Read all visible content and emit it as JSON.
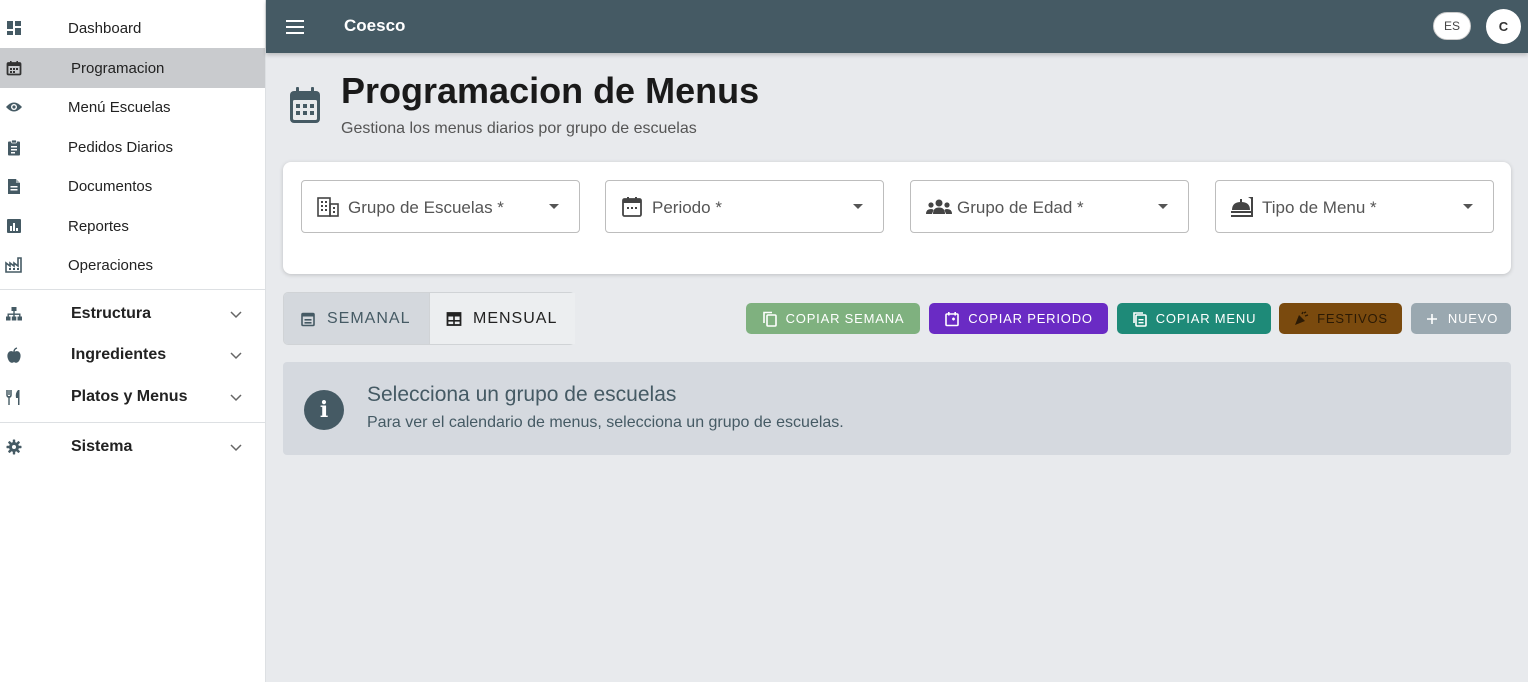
{
  "sidebar": {
    "items": [
      {
        "label": "Dashboard",
        "icon": "dashboard-icon"
      },
      {
        "label": "Programacion",
        "icon": "calendar-icon",
        "active": true
      },
      {
        "label": "Menú Escuelas",
        "icon": "eye-icon"
      },
      {
        "label": "Pedidos Diarios",
        "icon": "clipboard-icon"
      },
      {
        "label": "Documentos",
        "icon": "document-icon"
      },
      {
        "label": "Reportes",
        "icon": "chart-icon"
      },
      {
        "label": "Operaciones",
        "icon": "factory-icon"
      }
    ],
    "groups": [
      {
        "label": "Estructura",
        "icon": "sitemap-icon"
      },
      {
        "label": "Ingredientes",
        "icon": "apple-icon"
      },
      {
        "label": "Platos y Menus",
        "icon": "utensils-icon"
      },
      {
        "label": "Sistema",
        "icon": "gear-icon"
      }
    ]
  },
  "topbar": {
    "title": "Coesco",
    "language": "ES",
    "avatar_initial": "C"
  },
  "header": {
    "title": "Programacion de Menus",
    "subtitle": "Gestiona los menus diarios por grupo de escuelas"
  },
  "filters": [
    {
      "placeholder": "Grupo de Escuelas *",
      "icon": "building-icon"
    },
    {
      "placeholder": "Periodo *",
      "icon": "calendar-icon"
    },
    {
      "placeholder": "Grupo de Edad *",
      "icon": "people-icon"
    },
    {
      "placeholder": "Tipo de Menu *",
      "icon": "food-tray-icon"
    }
  ],
  "view_toggle": {
    "weekly": "SEMANAL",
    "monthly": "MENSUAL",
    "selected": "weekly"
  },
  "actions": {
    "copy_week": "COPIAR SEMANA",
    "copy_period": "COPIAR PERIODO",
    "copy_menu": "COPIAR MENU",
    "holidays": "FESTIVOS",
    "new": "NUEVO"
  },
  "colors": {
    "primary": "#455a64",
    "copy_week": "#7fb17f",
    "copy_period": "#6a2bc4",
    "copy_menu": "#1e8a78",
    "holidays": "#7a4a0e",
    "new": "#9aa8b0"
  },
  "info": {
    "title": "Selecciona un grupo de escuelas",
    "text": "Para ver el calendario de menus, selecciona un grupo de escuelas."
  }
}
